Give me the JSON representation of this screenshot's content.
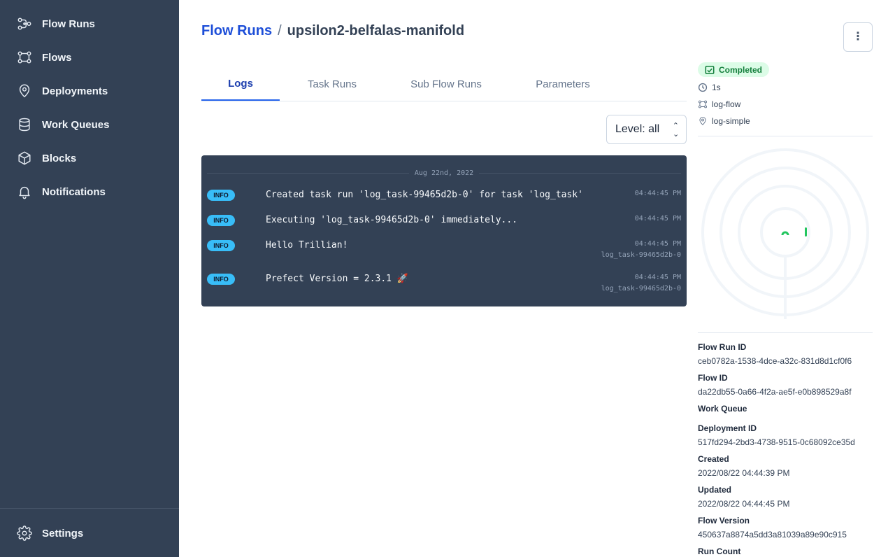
{
  "sidebar": {
    "items": [
      {
        "label": "Flow Runs",
        "icon": "flow-runs-icon"
      },
      {
        "label": "Flows",
        "icon": "flows-icon"
      },
      {
        "label": "Deployments",
        "icon": "map-pin-icon"
      },
      {
        "label": "Work Queues",
        "icon": "database-icon"
      },
      {
        "label": "Blocks",
        "icon": "cube-icon"
      },
      {
        "label": "Notifications",
        "icon": "bell-icon"
      }
    ],
    "settings_label": "Settings"
  },
  "header": {
    "breadcrumb_link": "Flow Runs",
    "breadcrumb_sep": "/",
    "title": "upsilon2-belfalas-manifold",
    "menu_glyph": "⋮"
  },
  "tabs": [
    {
      "label": "Logs",
      "active": true
    },
    {
      "label": "Task Runs",
      "active": false
    },
    {
      "label": "Sub Flow Runs",
      "active": false
    },
    {
      "label": "Parameters",
      "active": false
    }
  ],
  "level_filter": {
    "value": "Level: all"
  },
  "logs": {
    "date": "Aug 22nd, 2022",
    "entries": [
      {
        "level": "INFO",
        "message": "Created task run 'log_task-99465d2b-0' for task 'log_task'",
        "time": "04:44:45 PM",
        "task": ""
      },
      {
        "level": "INFO",
        "message": "Executing 'log_task-99465d2b-0' immediately...",
        "time": "04:44:45 PM",
        "task": ""
      },
      {
        "level": "INFO",
        "message": "Hello Trillian!",
        "time": "04:44:45 PM",
        "task": "log_task-99465d2b-0"
      },
      {
        "level": "INFO",
        "message": "Prefect Version = 2.3.1 🚀",
        "time": "04:44:45 PM",
        "task": "log_task-99465d2b-0"
      }
    ]
  },
  "details": {
    "state": "Completed",
    "state_color": "#15803d",
    "duration": "1s",
    "flow_name": "log-flow",
    "deployment_name": "log-simple",
    "fields": [
      {
        "label": "Flow Run ID",
        "value": "ceb0782a-1538-4dce-a32c-831d8d1cf0f6"
      },
      {
        "label": "Flow ID",
        "value": "da22db55-0a66-4f2a-ae5f-e0b898529a8f"
      },
      {
        "label": "Work Queue",
        "value": ""
      },
      {
        "label": "Deployment ID",
        "value": "517fd294-2bd3-4738-9515-0c68092ce35d"
      },
      {
        "label": "Created",
        "value": "2022/08/22 04:44:39 PM"
      },
      {
        "label": "Updated",
        "value": "2022/08/22 04:44:45 PM"
      },
      {
        "label": "Flow Version",
        "value": "450637a8874a5dd3a81039a89e90c915"
      },
      {
        "label": "Run Count",
        "value": ""
      }
    ]
  },
  "colors": {
    "sidebar_bg": "#334155",
    "accent": "#2563eb",
    "log_bg": "#334155",
    "info_badge": "#38bdf8",
    "radar_green": "#22c55e"
  }
}
